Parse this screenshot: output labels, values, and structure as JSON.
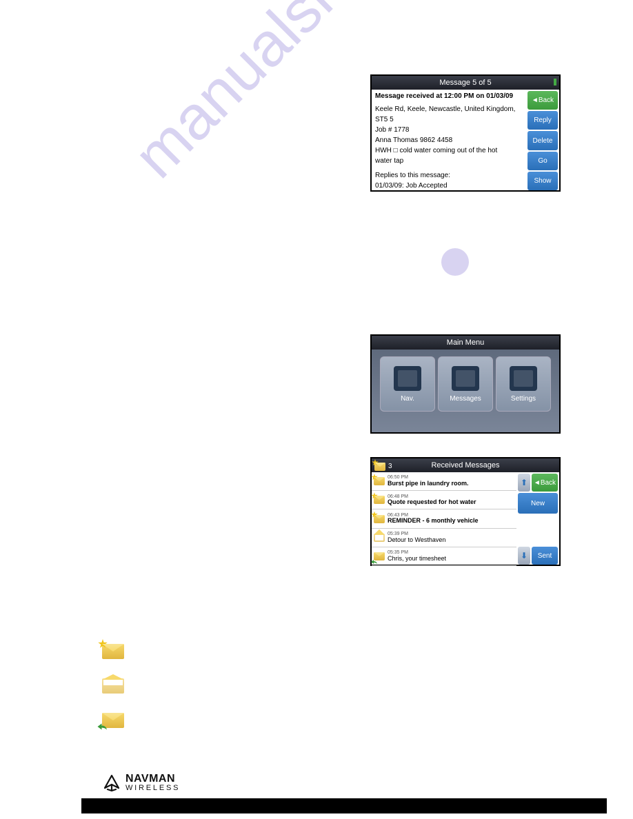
{
  "watermark": "manualshive.com",
  "screen1": {
    "title": "Message 5 of 5",
    "line1": "Message received at 12:00 PM on 01/03/09",
    "addr1": "Keele Rd, Keele, Newcastle, United Kingdom,",
    "addr2": "ST5 5",
    "job": "Job # 1778",
    "contact": "Anna Thomas 9862 4458",
    "desc1": "HWH □ cold water coming out of the hot",
    "desc2": "water tap",
    "replies_h": "Replies to this message:",
    "reply1": "01/03/09: Job Accepted",
    "buttons": {
      "back": "◄Back",
      "reply": "Reply",
      "delete": "Delete",
      "go": "Go",
      "show": "Show"
    }
  },
  "screen2": {
    "title": "Main Menu",
    "items": [
      {
        "label": "Nav."
      },
      {
        "label": "Messages"
      },
      {
        "label": "Settings"
      }
    ]
  },
  "screen3": {
    "title": "Received Messages",
    "count": "3",
    "rows": [
      {
        "time": "06:50 PM",
        "subject": "Burst pipe in laundry room.",
        "icon": "unread"
      },
      {
        "time": "06:48 PM",
        "subject": "Quote requested for hot water",
        "icon": "unread"
      },
      {
        "time": "06:43 PM",
        "subject": "REMINDER - 6 monthly vehicle",
        "icon": "unread"
      },
      {
        "time": "05:39 PM",
        "subject": "Detour to Westhaven",
        "icon": "read"
      },
      {
        "time": "05:35 PM",
        "subject": "Chris, your timesheet",
        "icon": "replied-sent"
      }
    ],
    "buttons": {
      "back": "◄Back",
      "new": "New",
      "sent": "Sent"
    }
  },
  "footer": {
    "brand": "NAVMAN",
    "sub": "WIRELESS"
  }
}
